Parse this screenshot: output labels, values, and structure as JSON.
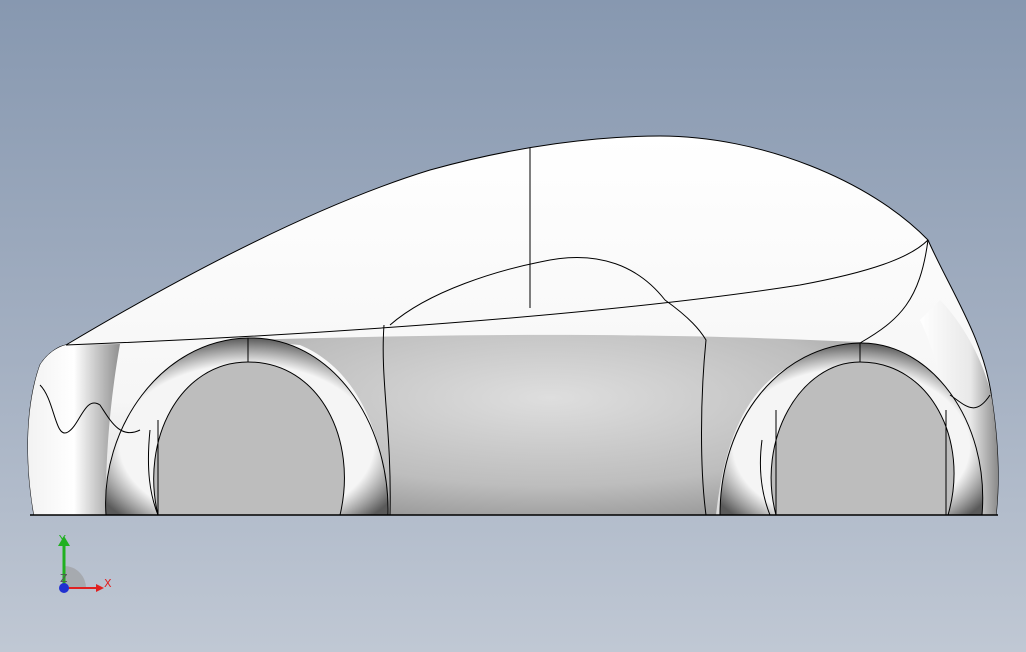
{
  "viewport": {
    "name": "3d-model-viewport",
    "background_top": "#8798b0",
    "background_bottom": "#c0c8d4"
  },
  "model": {
    "type": "car-body-side-view",
    "body_color": "#ffffff",
    "side_panel_color": "#c8c8c8",
    "wheel_well_color": "#bdbdbd",
    "edge_color": "#000000"
  },
  "triad": {
    "x_label": "X",
    "y_label": "Y",
    "z_label": "Z",
    "x_color": "#e02020",
    "y_color": "#20b020",
    "z_color": "#2030d0"
  }
}
